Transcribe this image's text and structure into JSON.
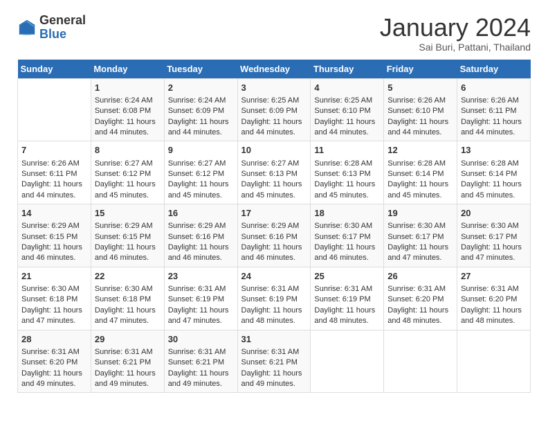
{
  "header": {
    "logo_general": "General",
    "logo_blue": "Blue",
    "title": "January 2024",
    "subtitle": "Sai Buri, Pattani, Thailand"
  },
  "days_of_week": [
    "Sunday",
    "Monday",
    "Tuesday",
    "Wednesday",
    "Thursday",
    "Friday",
    "Saturday"
  ],
  "weeks": [
    [
      {
        "day": "",
        "sunrise": "",
        "sunset": "",
        "daylight": ""
      },
      {
        "day": "1",
        "sunrise": "Sunrise: 6:24 AM",
        "sunset": "Sunset: 6:08 PM",
        "daylight": "Daylight: 11 hours and 44 minutes."
      },
      {
        "day": "2",
        "sunrise": "Sunrise: 6:24 AM",
        "sunset": "Sunset: 6:09 PM",
        "daylight": "Daylight: 11 hours and 44 minutes."
      },
      {
        "day": "3",
        "sunrise": "Sunrise: 6:25 AM",
        "sunset": "Sunset: 6:09 PM",
        "daylight": "Daylight: 11 hours and 44 minutes."
      },
      {
        "day": "4",
        "sunrise": "Sunrise: 6:25 AM",
        "sunset": "Sunset: 6:10 PM",
        "daylight": "Daylight: 11 hours and 44 minutes."
      },
      {
        "day": "5",
        "sunrise": "Sunrise: 6:26 AM",
        "sunset": "Sunset: 6:10 PM",
        "daylight": "Daylight: 11 hours and 44 minutes."
      },
      {
        "day": "6",
        "sunrise": "Sunrise: 6:26 AM",
        "sunset": "Sunset: 6:11 PM",
        "daylight": "Daylight: 11 hours and 44 minutes."
      }
    ],
    [
      {
        "day": "7",
        "sunrise": "Sunrise: 6:26 AM",
        "sunset": "Sunset: 6:11 PM",
        "daylight": "Daylight: 11 hours and 44 minutes."
      },
      {
        "day": "8",
        "sunrise": "Sunrise: 6:27 AM",
        "sunset": "Sunset: 6:12 PM",
        "daylight": "Daylight: 11 hours and 45 minutes."
      },
      {
        "day": "9",
        "sunrise": "Sunrise: 6:27 AM",
        "sunset": "Sunset: 6:12 PM",
        "daylight": "Daylight: 11 hours and 45 minutes."
      },
      {
        "day": "10",
        "sunrise": "Sunrise: 6:27 AM",
        "sunset": "Sunset: 6:13 PM",
        "daylight": "Daylight: 11 hours and 45 minutes."
      },
      {
        "day": "11",
        "sunrise": "Sunrise: 6:28 AM",
        "sunset": "Sunset: 6:13 PM",
        "daylight": "Daylight: 11 hours and 45 minutes."
      },
      {
        "day": "12",
        "sunrise": "Sunrise: 6:28 AM",
        "sunset": "Sunset: 6:14 PM",
        "daylight": "Daylight: 11 hours and 45 minutes."
      },
      {
        "day": "13",
        "sunrise": "Sunrise: 6:28 AM",
        "sunset": "Sunset: 6:14 PM",
        "daylight": "Daylight: 11 hours and 45 minutes."
      }
    ],
    [
      {
        "day": "14",
        "sunrise": "Sunrise: 6:29 AM",
        "sunset": "Sunset: 6:15 PM",
        "daylight": "Daylight: 11 hours and 46 minutes."
      },
      {
        "day": "15",
        "sunrise": "Sunrise: 6:29 AM",
        "sunset": "Sunset: 6:15 PM",
        "daylight": "Daylight: 11 hours and 46 minutes."
      },
      {
        "day": "16",
        "sunrise": "Sunrise: 6:29 AM",
        "sunset": "Sunset: 6:16 PM",
        "daylight": "Daylight: 11 hours and 46 minutes."
      },
      {
        "day": "17",
        "sunrise": "Sunrise: 6:29 AM",
        "sunset": "Sunset: 6:16 PM",
        "daylight": "Daylight: 11 hours and 46 minutes."
      },
      {
        "day": "18",
        "sunrise": "Sunrise: 6:30 AM",
        "sunset": "Sunset: 6:17 PM",
        "daylight": "Daylight: 11 hours and 46 minutes."
      },
      {
        "day": "19",
        "sunrise": "Sunrise: 6:30 AM",
        "sunset": "Sunset: 6:17 PM",
        "daylight": "Daylight: 11 hours and 47 minutes."
      },
      {
        "day": "20",
        "sunrise": "Sunrise: 6:30 AM",
        "sunset": "Sunset: 6:17 PM",
        "daylight": "Daylight: 11 hours and 47 minutes."
      }
    ],
    [
      {
        "day": "21",
        "sunrise": "Sunrise: 6:30 AM",
        "sunset": "Sunset: 6:18 PM",
        "daylight": "Daylight: 11 hours and 47 minutes."
      },
      {
        "day": "22",
        "sunrise": "Sunrise: 6:30 AM",
        "sunset": "Sunset: 6:18 PM",
        "daylight": "Daylight: 11 hours and 47 minutes."
      },
      {
        "day": "23",
        "sunrise": "Sunrise: 6:31 AM",
        "sunset": "Sunset: 6:19 PM",
        "daylight": "Daylight: 11 hours and 47 minutes."
      },
      {
        "day": "24",
        "sunrise": "Sunrise: 6:31 AM",
        "sunset": "Sunset: 6:19 PM",
        "daylight": "Daylight: 11 hours and 48 minutes."
      },
      {
        "day": "25",
        "sunrise": "Sunrise: 6:31 AM",
        "sunset": "Sunset: 6:19 PM",
        "daylight": "Daylight: 11 hours and 48 minutes."
      },
      {
        "day": "26",
        "sunrise": "Sunrise: 6:31 AM",
        "sunset": "Sunset: 6:20 PM",
        "daylight": "Daylight: 11 hours and 48 minutes."
      },
      {
        "day": "27",
        "sunrise": "Sunrise: 6:31 AM",
        "sunset": "Sunset: 6:20 PM",
        "daylight": "Daylight: 11 hours and 48 minutes."
      }
    ],
    [
      {
        "day": "28",
        "sunrise": "Sunrise: 6:31 AM",
        "sunset": "Sunset: 6:20 PM",
        "daylight": "Daylight: 11 hours and 49 minutes."
      },
      {
        "day": "29",
        "sunrise": "Sunrise: 6:31 AM",
        "sunset": "Sunset: 6:21 PM",
        "daylight": "Daylight: 11 hours and 49 minutes."
      },
      {
        "day": "30",
        "sunrise": "Sunrise: 6:31 AM",
        "sunset": "Sunset: 6:21 PM",
        "daylight": "Daylight: 11 hours and 49 minutes."
      },
      {
        "day": "31",
        "sunrise": "Sunrise: 6:31 AM",
        "sunset": "Sunset: 6:21 PM",
        "daylight": "Daylight: 11 hours and 49 minutes."
      },
      {
        "day": "",
        "sunrise": "",
        "sunset": "",
        "daylight": ""
      },
      {
        "day": "",
        "sunrise": "",
        "sunset": "",
        "daylight": ""
      },
      {
        "day": "",
        "sunrise": "",
        "sunset": "",
        "daylight": ""
      }
    ]
  ]
}
